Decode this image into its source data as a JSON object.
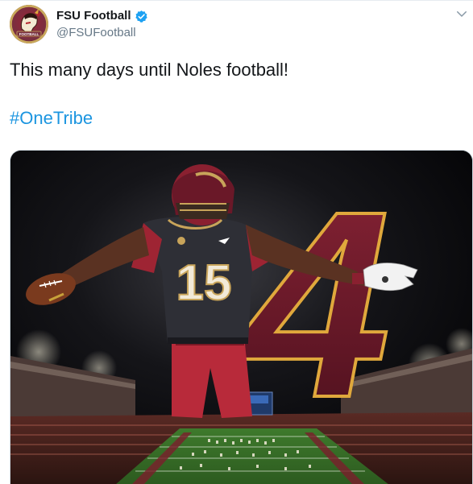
{
  "account": {
    "display_name": "FSU Football",
    "handle": "@FSUFootball",
    "verified": true,
    "avatar_icon": "fsu-seminole-logo",
    "avatar_text": "FOOTBALL"
  },
  "tweet": {
    "text": "This many days until Noles football!",
    "hashtag": "#OneTribe"
  },
  "media": {
    "description_icon": "football-player-countdown-graphic",
    "jersey_number": "15",
    "countdown_number": "4"
  },
  "colors": {
    "hashtag": "#1b95e0",
    "verified": "#1da1f2",
    "garnet": "#782f40",
    "gold": "#ceb888",
    "handle_gray": "#657786"
  }
}
